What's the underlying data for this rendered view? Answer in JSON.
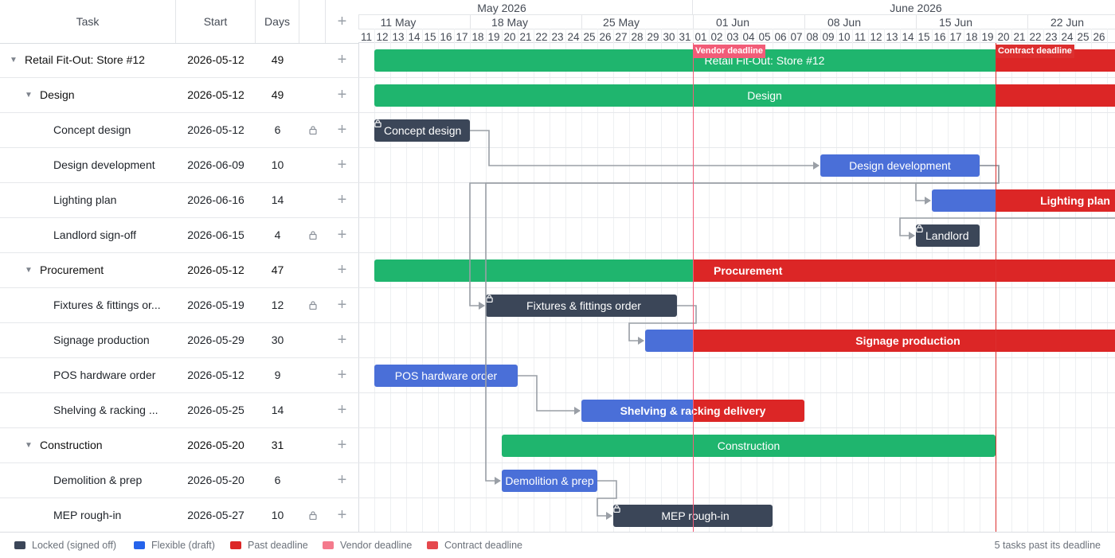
{
  "columns": {
    "task": "Task",
    "start": "Start",
    "days": "Days",
    "add": "+"
  },
  "timeline": {
    "start_date": "2026-05-11",
    "months": [
      {
        "label": "May 2026",
        "date": "2026-05-20"
      },
      {
        "label": "June 2026",
        "date": "2026-06-15"
      }
    ],
    "weeks": [
      {
        "label": "11 May",
        "date": "2026-05-11"
      },
      {
        "label": "18 May",
        "date": "2026-05-18"
      },
      {
        "label": "25 May",
        "date": "2026-05-25"
      },
      {
        "label": "01 Jun",
        "date": "2026-06-01"
      },
      {
        "label": "08 Jun",
        "date": "2026-06-08"
      },
      {
        "label": "15 Jun",
        "date": "2026-06-15"
      },
      {
        "label": "22 Jun",
        "date": "2026-06-22"
      }
    ],
    "days": [
      "11",
      "12",
      "13",
      "14",
      "15",
      "16",
      "17",
      "18",
      "19",
      "20",
      "21",
      "22",
      "23",
      "24",
      "25",
      "26",
      "27",
      "28",
      "29",
      "30",
      "31",
      "01",
      "02",
      "03",
      "04",
      "05",
      "06",
      "07",
      "08",
      "09",
      "10",
      "11",
      "12",
      "13",
      "14",
      "15",
      "16",
      "17",
      "18",
      "19",
      "20",
      "21",
      "22",
      "23",
      "24",
      "25",
      "26"
    ]
  },
  "deadlines": [
    {
      "label": "Vendor deadline",
      "date": "2026-06-01",
      "color": "#f25c78"
    },
    {
      "label": "Contract deadline",
      "date": "2026-06-20",
      "color": "#dc2f2f"
    }
  ],
  "tasks": [
    {
      "id": "t0",
      "name": "Retail Fit-Out: Store #12",
      "start": "2026-05-12",
      "days": "49",
      "level": 0,
      "type": "summary",
      "locked": false,
      "bar": "Retail Fit-Out: Store #12"
    },
    {
      "id": "t1",
      "name": "Design",
      "start": "2026-05-12",
      "days": "49",
      "level": 1,
      "type": "summary",
      "locked": false,
      "bar": "Design"
    },
    {
      "id": "t2",
      "name": "Concept design",
      "start": "2026-05-12",
      "days": "6",
      "level": 2,
      "type": "task",
      "locked": true,
      "bar": "Concept design"
    },
    {
      "id": "t3",
      "name": "Design development",
      "start": "2026-06-09",
      "days": "10",
      "level": 2,
      "type": "task",
      "locked": false,
      "bar": "Design development"
    },
    {
      "id": "t4",
      "name": "Lighting plan",
      "start": "2026-06-16",
      "days": "14",
      "level": 2,
      "type": "task",
      "locked": false,
      "bar": "Lighting plan"
    },
    {
      "id": "t5",
      "name": "Landlord sign-off",
      "start": "2026-06-15",
      "days": "4",
      "level": 2,
      "type": "task",
      "locked": true,
      "bar": "Landlord"
    },
    {
      "id": "t6",
      "name": "Procurement",
      "start": "2026-05-12",
      "days": "47",
      "level": 1,
      "type": "summary",
      "locked": false,
      "bar": "Procurement"
    },
    {
      "id": "t7",
      "name": "Fixtures & fittings or...",
      "start": "2026-05-19",
      "days": "12",
      "level": 2,
      "type": "task",
      "locked": true,
      "bar": "Fixtures & fittings order"
    },
    {
      "id": "t8",
      "name": "Signage production",
      "start": "2026-05-29",
      "days": "30",
      "level": 2,
      "type": "task",
      "locked": false,
      "bar": "Signage production"
    },
    {
      "id": "t9",
      "name": "POS hardware order",
      "start": "2026-05-12",
      "days": "9",
      "level": 2,
      "type": "task",
      "locked": false,
      "bar": "POS hardware order"
    },
    {
      "id": "t10",
      "name": "Shelving & racking ...",
      "start": "2026-05-25",
      "days": "14",
      "level": 2,
      "type": "task",
      "locked": false,
      "bar": "Shelving & racking delivery"
    },
    {
      "id": "t11",
      "name": "Construction",
      "start": "2026-05-20",
      "days": "31",
      "level": 1,
      "type": "summary",
      "locked": false,
      "bar": "Construction"
    },
    {
      "id": "t12",
      "name": "Demolition & prep",
      "start": "2026-05-20",
      "days": "6",
      "level": 2,
      "type": "task",
      "locked": false,
      "bar": "Demolition & prep"
    },
    {
      "id": "t13",
      "name": "MEP rough-in",
      "start": "2026-05-27",
      "days": "10",
      "level": 2,
      "type": "task",
      "locked": true,
      "bar": "MEP rough-in"
    }
  ],
  "links": [
    {
      "from": "t2",
      "to": "t3"
    },
    {
      "from": "t3",
      "to": "t4"
    },
    {
      "from": "t3",
      "to": "t7"
    },
    {
      "from": "t3",
      "to": "t12"
    },
    {
      "from": "t4",
      "to": "t5"
    },
    {
      "from": "t7",
      "to": "t8"
    },
    {
      "from": "t9",
      "to": "t10"
    },
    {
      "from": "t12",
      "to": "t13"
    }
  ],
  "colors": {
    "summary": "#1fb56e",
    "task": "#4a6fd8",
    "locked": "#3b4658",
    "late": "#dc2626"
  },
  "legend": [
    {
      "label": "Locked (signed off)",
      "color": "#3b4658"
    },
    {
      "label": "Flexible (draft)",
      "color": "#2563eb"
    },
    {
      "label": "Past deadline",
      "color": "#dc2626"
    },
    {
      "label": "Vendor deadline",
      "color": "#f47a8c"
    },
    {
      "label": "Contract deadline",
      "color": "#e5484d"
    }
  ],
  "summary_text": "5 tasks past its deadline",
  "icons": {
    "lock": "lock-icon",
    "collapse": "chevron-down-icon",
    "add": "plus-icon"
  }
}
